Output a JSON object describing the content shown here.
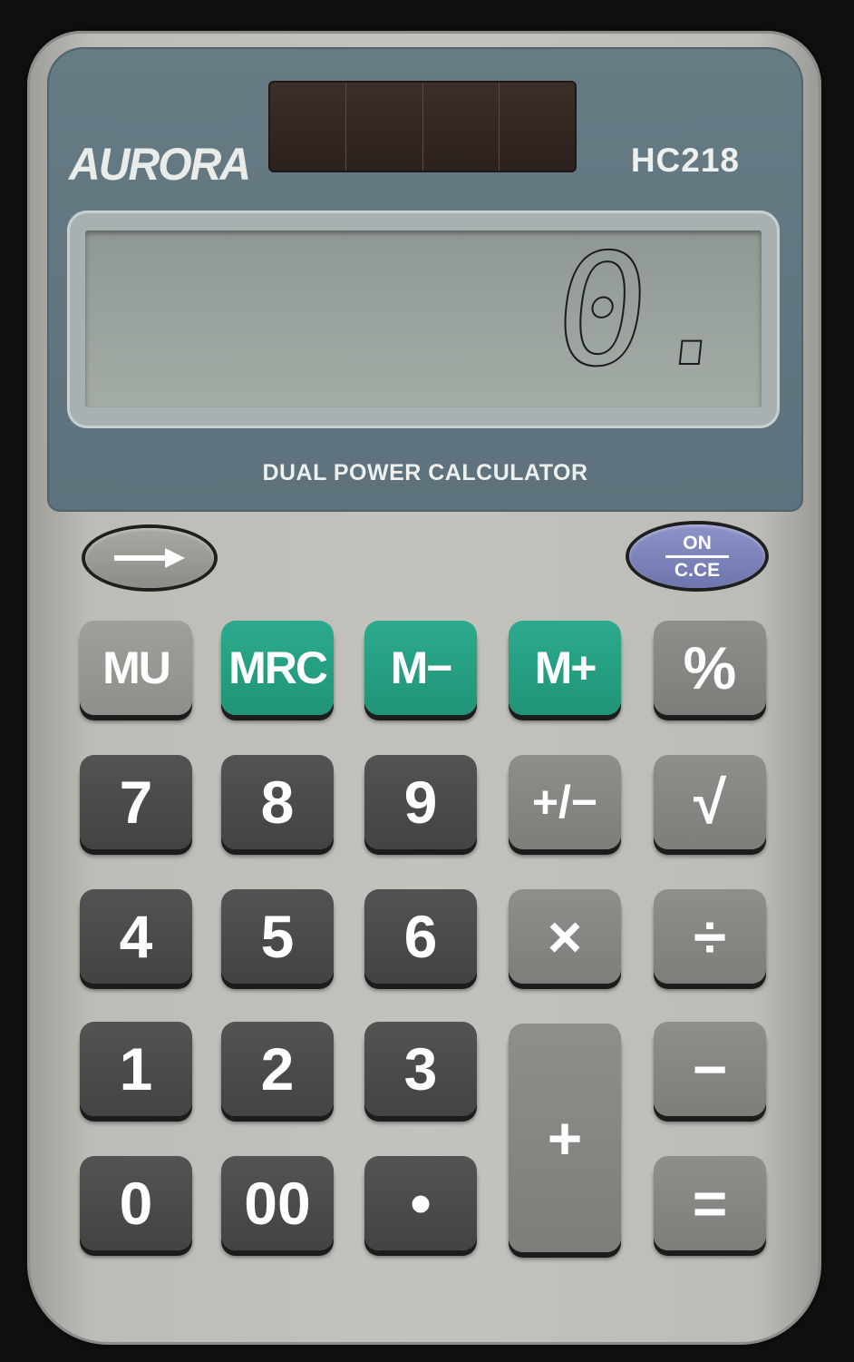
{
  "brand": "AURORA",
  "model": "HC218",
  "display_value": "0.",
  "tagline": "DUAL POWER CALCULATOR",
  "top_buttons": {
    "arrow": "→",
    "on_top": "ON",
    "on_bottom": "C.CE"
  },
  "keys": {
    "mu": "MU",
    "mrc": "MRC",
    "m_minus": "M−",
    "m_plus": "M+",
    "percent": "%",
    "seven": "7",
    "eight": "8",
    "nine": "9",
    "plus_minus": "+/−",
    "sqrt": "√",
    "four": "4",
    "five": "5",
    "six": "6",
    "multiply": "×",
    "divide": "÷",
    "one": "1",
    "two": "2",
    "three": "3",
    "plus": "+",
    "minus": "−",
    "zero": "0",
    "double_zero": "00",
    "decimal": "•",
    "equals": "="
  },
  "colors": {
    "panel": "#5f747e",
    "memory_keys": "#24a083",
    "number_keys": "#4a4b4a",
    "function_keys": "#878682",
    "on_key": "#7d83bb"
  }
}
